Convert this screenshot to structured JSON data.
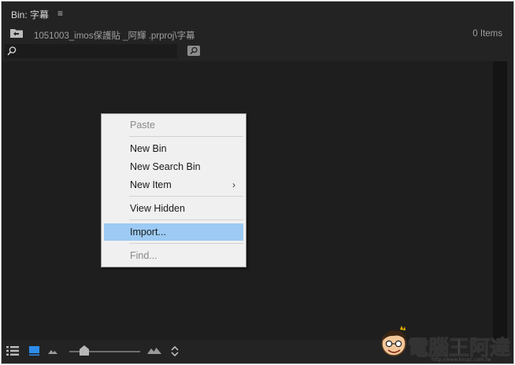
{
  "panel": {
    "title": "Bin: 字幕",
    "menu_glyph": "≡",
    "path": "1051003_imos保護貼 _阿輝 .prproj\\字幕",
    "items_count": "0 Items"
  },
  "search": {
    "value": "",
    "placeholder": ""
  },
  "context_menu": {
    "items": [
      {
        "label": "Paste",
        "state": "disabled"
      },
      {
        "label": "New Bin",
        "state": "enabled"
      },
      {
        "label": "New Search Bin",
        "state": "enabled"
      },
      {
        "label": "New Item",
        "state": "enabled",
        "submenu": "›"
      },
      {
        "label": "View Hidden",
        "state": "enabled"
      },
      {
        "label": "Import...",
        "state": "highlighted"
      },
      {
        "label": "Find...",
        "state": "disabled"
      }
    ]
  },
  "watermark": {
    "text": "電腦王阿達",
    "url": "http://www.kocpc.com.tw"
  },
  "colors": {
    "panel_bg": "#232323",
    "content_bg": "#1e1e1e",
    "menu_bg": "#f0f0f0",
    "menu_highlight": "#9ccaf4",
    "accent_blue": "#2d8ceb"
  }
}
